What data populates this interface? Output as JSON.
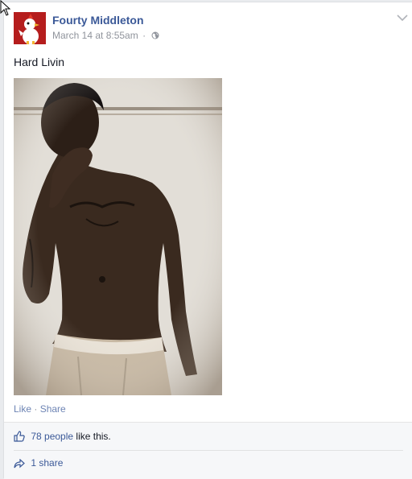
{
  "post": {
    "author": "Fourty Middleton",
    "timestamp": "March 14 at 8:55am",
    "separator": "·",
    "privacy_icon": "globe-icon",
    "text": "Hard Livin",
    "photo_description_icon": "photo-image"
  },
  "actions": {
    "like_label": "Like",
    "separator": "·",
    "share_label": "Share"
  },
  "feedback": {
    "likes_count_label": "78 people",
    "likes_suffix": "like this.",
    "shares_label": "1 share"
  },
  "colors": {
    "link": "#3b5998",
    "muted": "#90949c",
    "background": "#e9ebee",
    "feedback_bg": "#f6f7f9"
  }
}
